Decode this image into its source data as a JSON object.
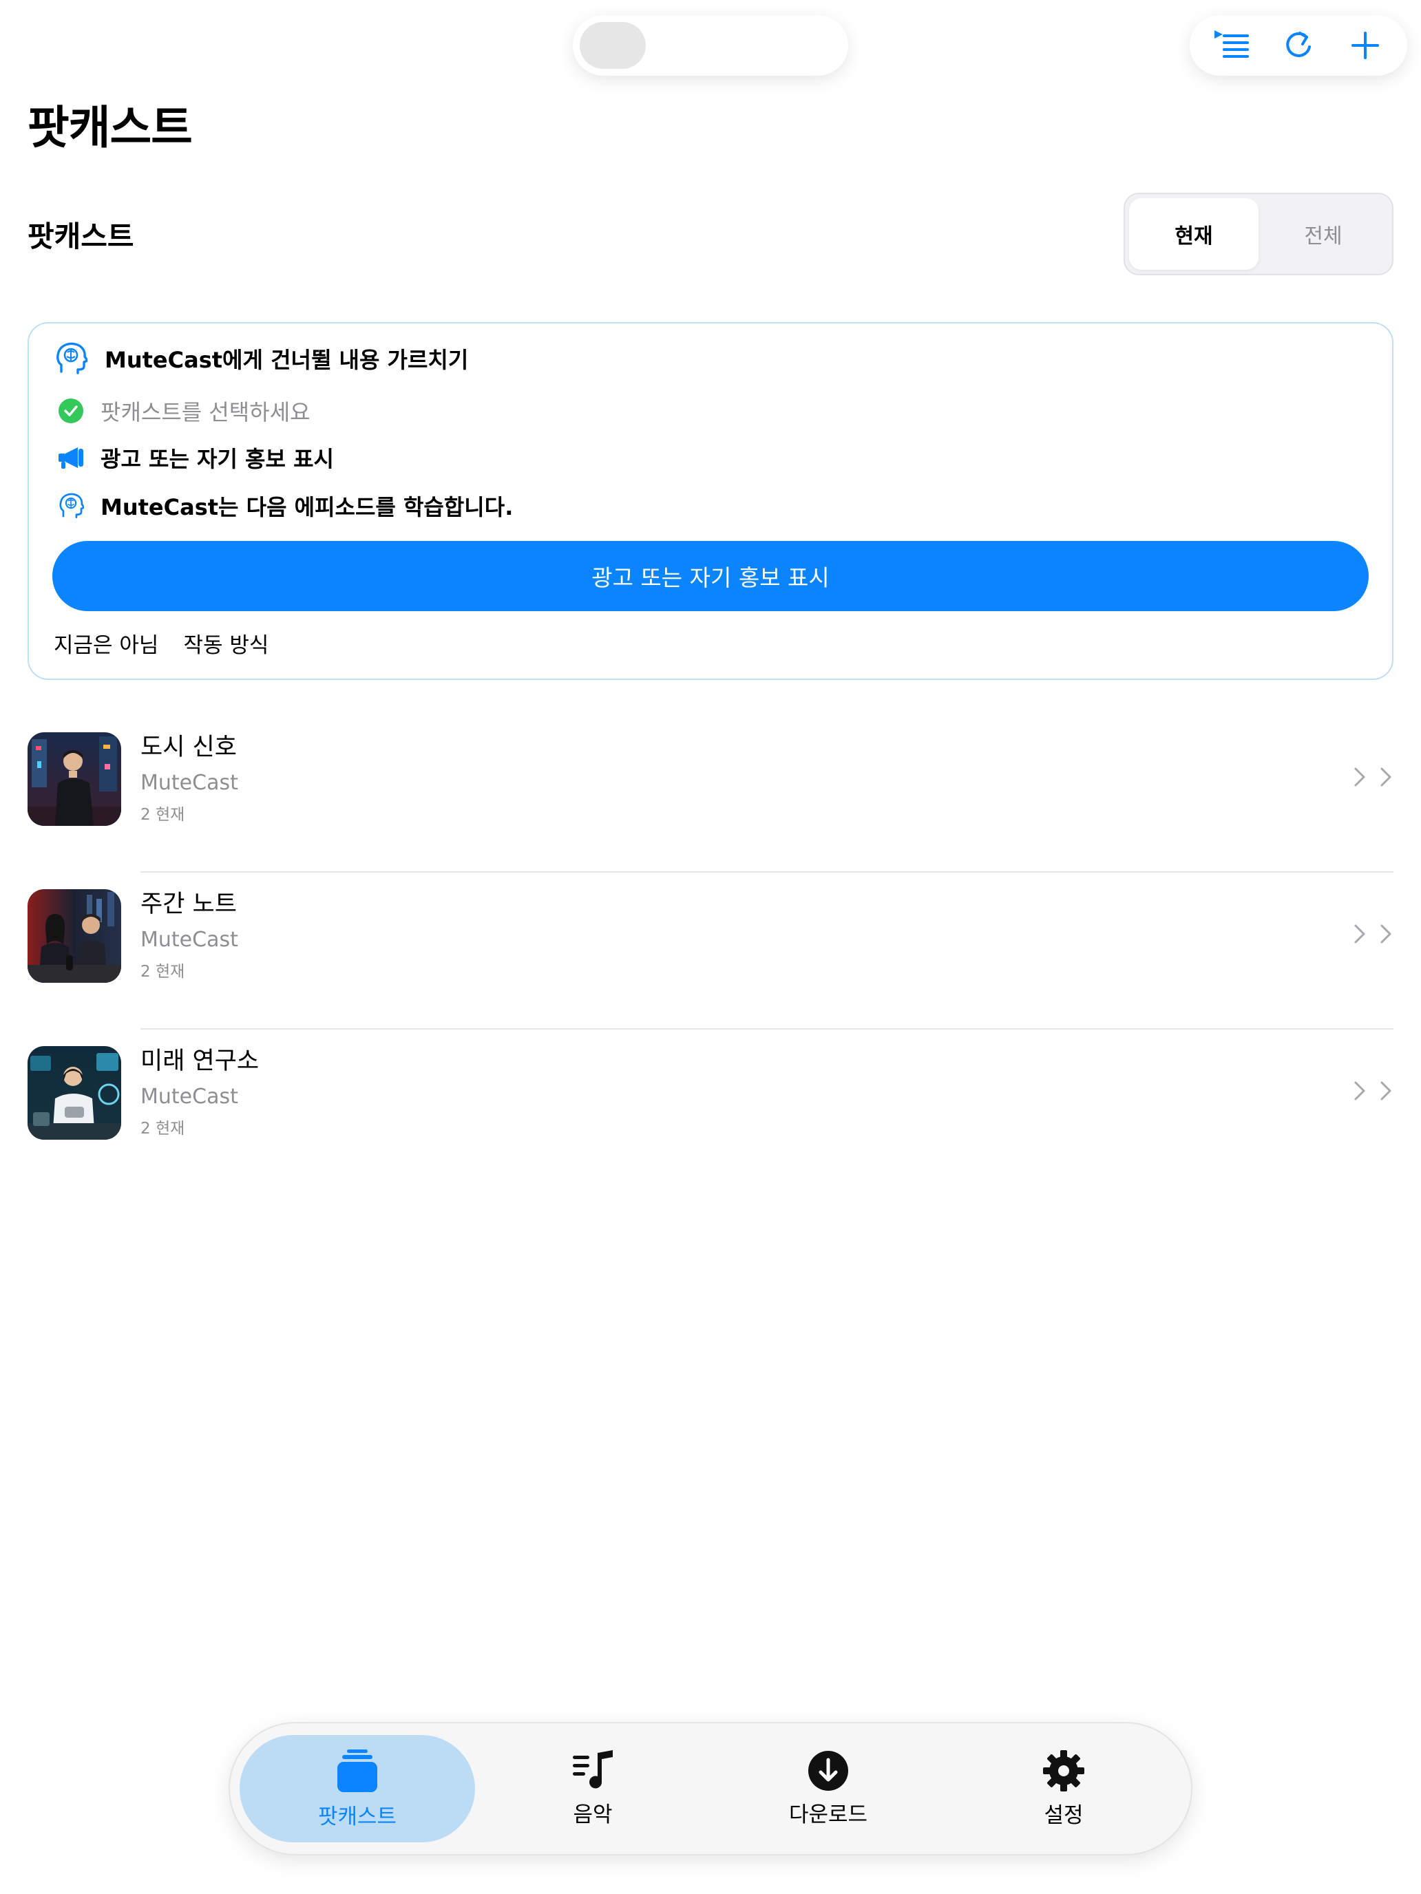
{
  "header": {
    "title": "팟캐스트"
  },
  "section": {
    "title": "팟캐스트"
  },
  "filter": {
    "segments": [
      {
        "label": "현재",
        "selected": true
      },
      {
        "label": "전체",
        "selected": false
      }
    ]
  },
  "teach_card": {
    "title": "MuteCast에게 건너뛸 내용 가르치기",
    "steps": [
      {
        "text": "팟캐스트를 선택하세요",
        "icon": "checkmark-circle-icon",
        "done": true
      },
      {
        "text": "광고 또는 자기 홍보 표시",
        "icon": "megaphone-icon",
        "done": false
      },
      {
        "text": "MuteCast는 다음 에피소드를 학습합니다.",
        "icon": "brain-head-icon",
        "done": false
      }
    ],
    "primary_button": "광고 또는 자기 홍보 표시",
    "links": [
      "지금은 아님",
      "작동 방식"
    ]
  },
  "podcasts": [
    {
      "title": "도시 신호",
      "author": "MuteCast",
      "count": "2 현재"
    },
    {
      "title": "주간 노트",
      "author": "MuteCast",
      "count": "2 현재"
    },
    {
      "title": "미래 연구소",
      "author": "MuteCast",
      "count": "2 현재"
    }
  ],
  "tab_bar": {
    "tabs": [
      {
        "label": "팟캐스트",
        "icon": "stack-icon",
        "active": true
      },
      {
        "label": "음악",
        "icon": "music-list-icon",
        "active": false
      },
      {
        "label": "다운로드",
        "icon": "download-circle-icon",
        "active": false
      },
      {
        "label": "설정",
        "icon": "gear-icon",
        "active": false
      }
    ]
  },
  "colors": {
    "accent": "#0a84ff",
    "success": "#34c759",
    "secondary_text": "#8e8e93"
  }
}
